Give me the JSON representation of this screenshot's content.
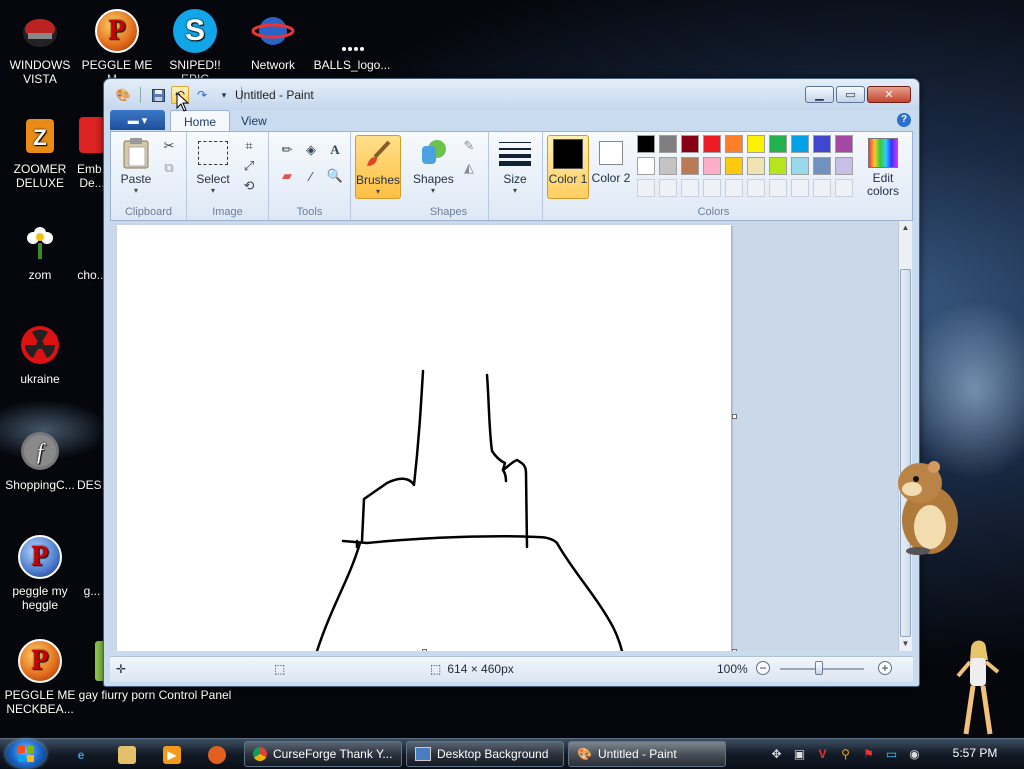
{
  "desktop": {
    "icons": [
      {
        "label": "WINDOWS VISTA"
      },
      {
        "label": "PEGGLE ME M..."
      },
      {
        "label": "SNIPED!! EPIC"
      },
      {
        "label": "Network"
      },
      {
        "label": "BALLS_logo..."
      },
      {
        "label": "ZOOMER DELUXE"
      },
      {
        "label": "Emb... De..."
      },
      {
        "label": "zom"
      },
      {
        "label": "cho..."
      },
      {
        "label": "ukraine"
      },
      {
        "label": "ShoppingC..."
      },
      {
        "label": "DES..."
      },
      {
        "label": "peggle my heggle"
      },
      {
        "label": "g..."
      },
      {
        "label": "PEGGLE ME NECKBEA..."
      },
      {
        "label": "gay fiurry porn"
      },
      {
        "label": "Control Panel"
      }
    ]
  },
  "paint": {
    "title": "Untitled - Paint",
    "tabs": [
      "Home",
      "View"
    ],
    "groups": {
      "clipboard": {
        "label": "Clipboard",
        "paste": "Paste"
      },
      "image": {
        "label": "Image",
        "select": "Select"
      },
      "tools": {
        "label": "Tools",
        "text_glyph": "A"
      },
      "brushes": {
        "label": "Brushes"
      },
      "shapes": {
        "label": "Shapes",
        "button": "Shapes"
      },
      "size": {
        "label": "Size"
      },
      "colors": {
        "label": "Colors",
        "color1": "Color 1",
        "color2": "Color 2",
        "edit": "Edit colors"
      }
    },
    "palette_row1": [
      "#000000",
      "#7f7f7f",
      "#880015",
      "#ed1c24",
      "#ff7f27",
      "#fff200",
      "#22b14c",
      "#00a2e8",
      "#3f48cc",
      "#a349a4"
    ],
    "palette_row2": [
      "#ffffff",
      "#c3c3c3",
      "#b97a57",
      "#ffaec9",
      "#ffc90e",
      "#efe4b0",
      "#b5e61d",
      "#99d9ea",
      "#7092be",
      "#c8bfe7"
    ],
    "color1_value": "#000000",
    "color2_value": "#ffffff",
    "status": {
      "image_size": "614 × 460px",
      "zoom": "100%",
      "zoom_level_percent": 100
    }
  },
  "taskbar": {
    "windows": [
      {
        "label": "CurseForge Thank Y..."
      },
      {
        "label": "Desktop Background"
      },
      {
        "label": "Untitled - Paint"
      }
    ],
    "clock": "5:57 PM"
  }
}
